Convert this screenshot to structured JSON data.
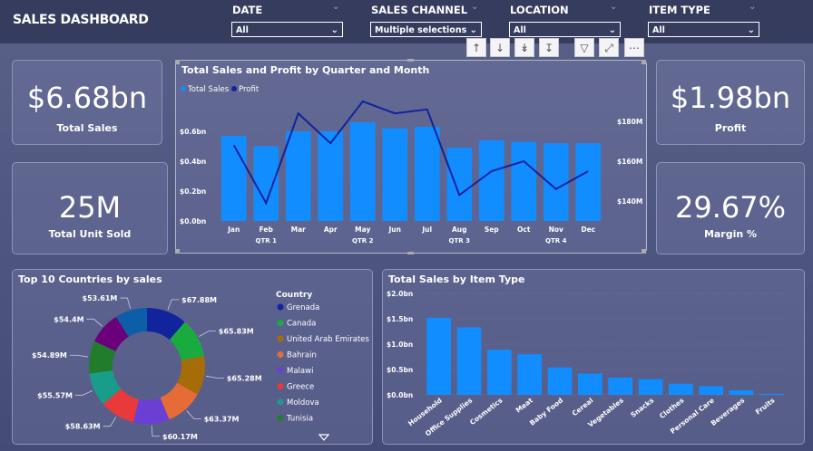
{
  "header": {
    "title": "SALES DASHBOARD"
  },
  "slicers": [
    {
      "label": "DATE",
      "value": "All"
    },
    {
      "label": "SALES CHANNEL",
      "value": "Multiple selections"
    },
    {
      "label": "LOCATION",
      "value": "All"
    },
    {
      "label": "ITEM TYPE",
      "value": "All"
    }
  ],
  "toolbar": [
    "arrow-up-icon",
    "arrow-down-icon",
    "double-arrow-down-icon",
    "expand-hierarchy-icon",
    "filter-icon",
    "focus-mode-icon",
    "more-options-icon"
  ],
  "kpis": {
    "total_sales": {
      "value": "$6.68bn",
      "label": "Total Sales"
    },
    "units": {
      "value": "25M",
      "label": "Total Unit Sold"
    },
    "profit": {
      "value": "$1.98bn",
      "label": "Profit"
    },
    "margin": {
      "value": "29.67%",
      "label": "Margin %"
    }
  },
  "colors": {
    "bar": "#118dff",
    "line": "#12239e",
    "panel_border": "#8d93b8"
  },
  "chart_data": [
    {
      "type": "bar",
      "title": "Total Sales and Profit by Quarter and Month",
      "legend": [
        "Total Sales",
        "Profit"
      ],
      "categories": [
        "Jan",
        "Feb",
        "Mar",
        "Apr",
        "May",
        "Jun",
        "Jul",
        "Aug",
        "Sep",
        "Oct",
        "Nov",
        "Dec"
      ],
      "quarters": [
        "QTR 1",
        "QTR 2",
        "QTR 3",
        "QTR 4"
      ],
      "series": [
        {
          "name": "Total Sales",
          "values": [
            0.57,
            0.5,
            0.6,
            0.6,
            0.66,
            0.62,
            0.63,
            0.49,
            0.54,
            0.53,
            0.52,
            0.52
          ]
        },
        {
          "name": "Profit",
          "values": [
            168,
            139,
            184,
            169,
            190,
            184,
            186,
            143,
            155,
            160,
            146,
            155
          ]
        }
      ],
      "y_ticks": [
        "$0.0bn",
        "$0.2bn",
        "$0.4bn",
        "$0.6bn"
      ],
      "y2_ticks": [
        "$140M",
        "$160M",
        "$180M"
      ],
      "ylim": [
        0,
        0.8
      ],
      "y2lim": [
        130,
        190
      ]
    },
    {
      "type": "pie",
      "title": "Top 10 Countries by sales",
      "legend_title": "Country",
      "legend": [
        "Grenada",
        "Canada",
        "United Arab Emirates",
        "Bahrain",
        "Malawi",
        "Greece",
        "Moldova",
        "Tunisia"
      ],
      "slices": [
        {
          "label": "$67.88M",
          "value": 67.88,
          "color": "#12239e"
        },
        {
          "label": "$65.83M",
          "value": 65.83,
          "color": "#1aab40"
        },
        {
          "label": "$65.28M",
          "value": 65.28,
          "color": "#a66c07"
        },
        {
          "label": "$63.37M",
          "value": 63.37,
          "color": "#e66c37"
        },
        {
          "label": "$60.17M",
          "value": 60.17,
          "color": "#6b3fd4"
        },
        {
          "label": "$58.63M",
          "value": 58.63,
          "color": "#e83a3a"
        },
        {
          "label": "$55.57M",
          "value": 55.57,
          "color": "#1a9c8a"
        },
        {
          "label": "$54.89M",
          "value": 54.89,
          "color": "#217d2c"
        },
        {
          "label": "$54.4M",
          "value": 54.4,
          "color": "#6b007b"
        },
        {
          "label": "$53.61M",
          "value": 53.61,
          "color": "#0d5ea6"
        }
      ],
      "legend_colors": [
        "#12239e",
        "#1aab40",
        "#a66c07",
        "#e66c37",
        "#6b3fd4",
        "#e83a3a",
        "#1a9c8a",
        "#217d2c"
      ]
    },
    {
      "type": "bar",
      "title": "Total Sales by Item Type",
      "categories": [
        "Household",
        "Office Supplies",
        "Cosmetics",
        "Meat",
        "Baby Food",
        "Cereal",
        "Vegetables",
        "Snacks",
        "Clothes",
        "Personal Care",
        "Beverages",
        "Fruits"
      ],
      "values": [
        1.52,
        1.33,
        0.89,
        0.8,
        0.54,
        0.42,
        0.34,
        0.31,
        0.22,
        0.17,
        0.09,
        0.02
      ],
      "y_ticks": [
        "$0.0bn",
        "$0.5bn",
        "$1.0bn",
        "$1.5bn",
        "$2.0bn"
      ],
      "ylim": [
        0,
        2.0
      ]
    }
  ]
}
